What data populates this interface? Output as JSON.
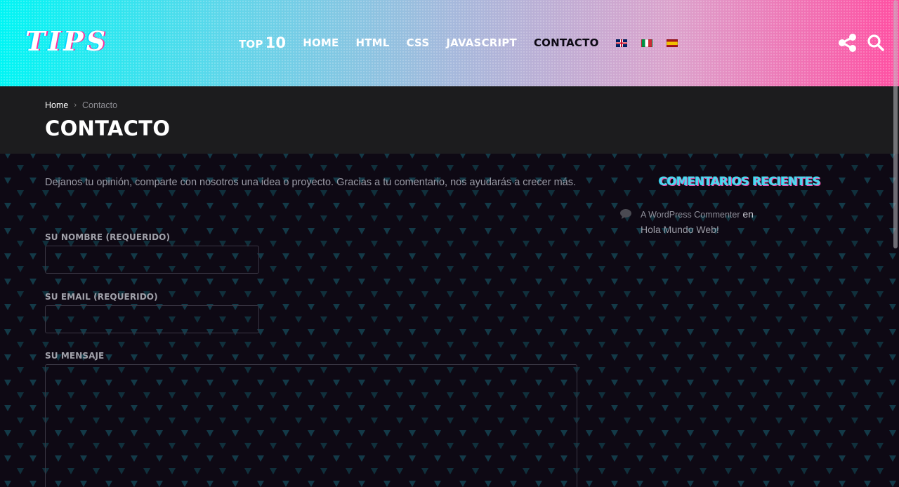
{
  "header": {
    "logo_text": "TIPS",
    "nav": {
      "top_label": "TOP",
      "top_number": "10",
      "home": "HOME",
      "html": "HTML",
      "css": "CSS",
      "javascript": "JAVASCRIPT",
      "contacto": "CONTACTO"
    },
    "languages": [
      "en",
      "it",
      "es"
    ],
    "icons": [
      "share-icon",
      "search-icon"
    ],
    "gradient_colors": [
      "#00f5f4",
      "#ff4fa2"
    ]
  },
  "breadcrumb": {
    "home": "Home",
    "separator": "›",
    "current": "Contacto"
  },
  "page": {
    "title": "CONTACTO",
    "intro": "Dejanos tu opinión, comparte con nosotros una idea o proyecto. Gracias a tu comentario, nos ayudarás a crecer más."
  },
  "form": {
    "name_label": "SU NOMBRE (REQUERIDO)",
    "name_value": "",
    "email_label": "SU EMAIL (REQUERIDO)",
    "email_value": "",
    "message_label": "SU MENSAJE",
    "message_value": ""
  },
  "sidebar": {
    "widget_title": "COMENTARIOS RECIENTES",
    "comments": [
      {
        "author": "A WordPress Commenter",
        "connector": "en",
        "post": "Hola Mundo Web!"
      }
    ]
  },
  "colors": {
    "accent_cyan": "#4fd8ee",
    "accent_pink": "#ff48a8",
    "background": "#0e0914",
    "title_bar": "#1c1c1e"
  }
}
